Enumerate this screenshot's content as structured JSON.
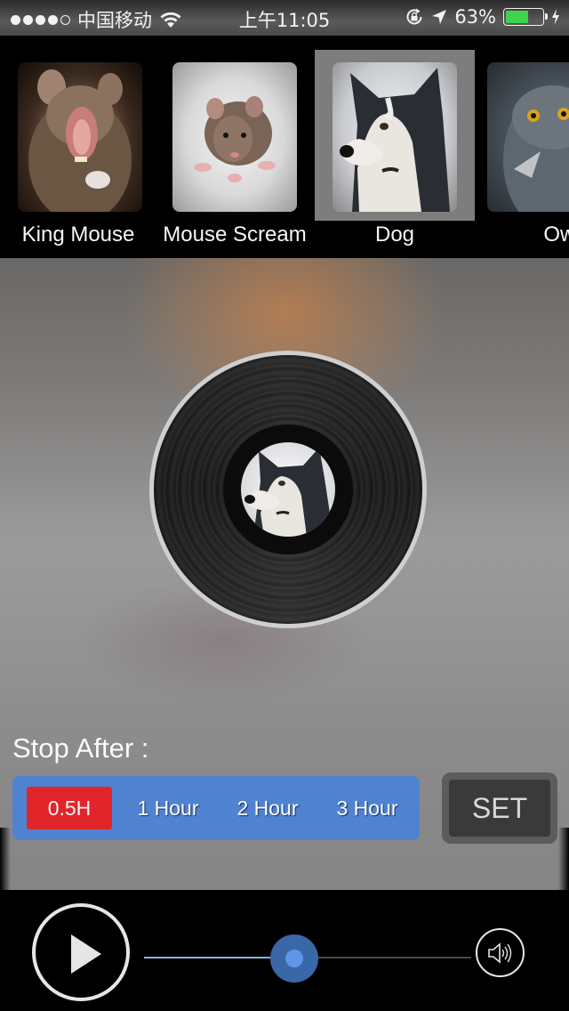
{
  "status_bar": {
    "signal_strength": "4 of 5",
    "carrier": "中国移动",
    "wifi_icon": "wifi-icon",
    "time": "上午11:05",
    "rotation_lock_icon": "rotation-lock-icon",
    "location_icon": "location-arrow-icon",
    "battery_percent": "63%",
    "battery_level": 0.63,
    "charging_icon": "bolt-icon"
  },
  "sounds": [
    {
      "label": "King Mouse",
      "selected": false
    },
    {
      "label": "Mouse Scream",
      "selected": false
    },
    {
      "label": "Dog",
      "selected": true
    },
    {
      "label": "Owl",
      "selected": false
    }
  ],
  "player_disc": {
    "now_playing": "Dog"
  },
  "timer": {
    "title": "Stop After :",
    "options": [
      "0.5H",
      "1 Hour",
      "2 Hour",
      "3 Hour"
    ],
    "selected_index": 0,
    "set_label": "SET",
    "accent_color": "#4f83d1",
    "selected_color": "#e0262a"
  },
  "controls": {
    "play_icon": "play-icon",
    "volume_icon": "speaker-icon",
    "progress": 0.46
  }
}
